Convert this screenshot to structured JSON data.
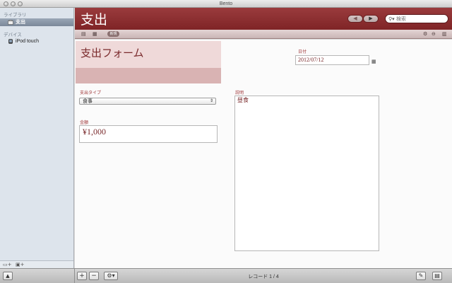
{
  "window": {
    "title": "Bento"
  },
  "sidebar": {
    "library_label": "ライブラリ",
    "library_items": [
      {
        "label": "支出",
        "selected": true
      }
    ],
    "devices_label": "デバイス",
    "device_items": [
      {
        "label": "iPod touch"
      }
    ]
  },
  "header": {
    "title": "支出",
    "nav_prev": "◀",
    "nav_next": "▶",
    "search_placeholder": "検索",
    "accent_color": "#8b2f31"
  },
  "toolbar": {
    "pill_label": "新規"
  },
  "form": {
    "form_title": "支出フォーム",
    "date_label": "日付",
    "date_value": "2012/07/12",
    "type_label": "支出タイプ",
    "type_value": "食事",
    "amount_label": "金額",
    "amount_value": "¥1,000",
    "note_label": "説明",
    "note_value": "昼食"
  },
  "bottombar": {
    "record_text": "レコード 1 / 4"
  }
}
